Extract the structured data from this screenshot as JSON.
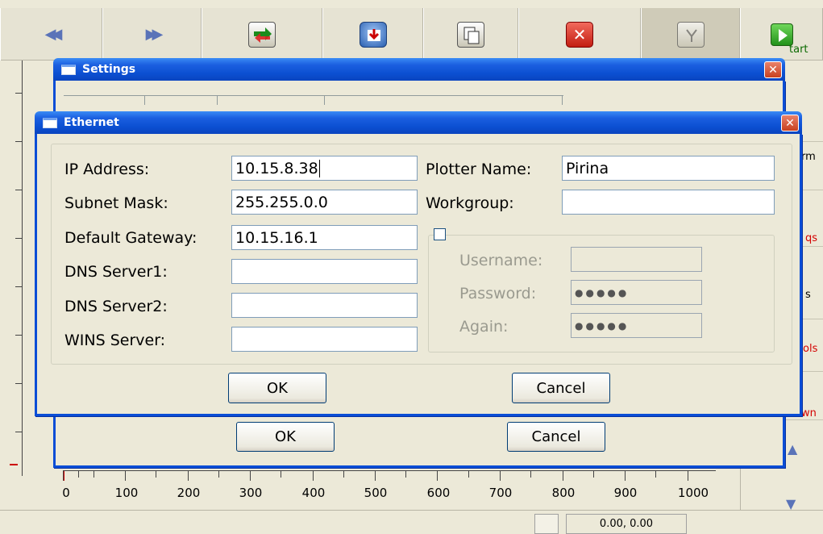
{
  "toolbar": {
    "icons": [
      "rewind-icon",
      "forward-icon",
      "transfer-icon",
      "download-icon",
      "copy-icon",
      "cancel-icon",
      "vector-icon",
      "start-icon"
    ],
    "start_label": "tart"
  },
  "right_panel": {
    "labels": [
      "rm",
      "qs",
      "s",
      "ols",
      "wn"
    ]
  },
  "ruler": {
    "x_labels": [
      "0",
      "100",
      "200",
      "300",
      "400",
      "500",
      "600",
      "700",
      "800",
      "900",
      "1000"
    ]
  },
  "status": {
    "coords": "0.00, 0.00"
  },
  "settings_dialog": {
    "title": "Settings",
    "ok_label": "OK",
    "cancel_label": "Cancel"
  },
  "ethernet_dialog": {
    "title": "Ethernet",
    "labels": {
      "ip": "IP Address:",
      "subnet": "Subnet Mask:",
      "gateway": "Default Gateway:",
      "dns1": "DNS Server1:",
      "dns2": "DNS Server2:",
      "wins": "WINS Server:",
      "plotter": "Plotter Name:",
      "workgroup": "Workgroup:",
      "username": "Username:",
      "password": "Password:",
      "again": "Again:"
    },
    "values": {
      "ip": "10.15.8.38",
      "subnet": "255.255.0.0",
      "gateway": "10.15.16.1",
      "dns1": "",
      "dns2": "",
      "wins": "",
      "plotter": "Pirina",
      "workgroup": "",
      "username": "",
      "password": "●●●●●",
      "again": "●●●●●"
    },
    "auth_checked": false,
    "ok_label": "OK",
    "cancel_label": "Cancel"
  }
}
